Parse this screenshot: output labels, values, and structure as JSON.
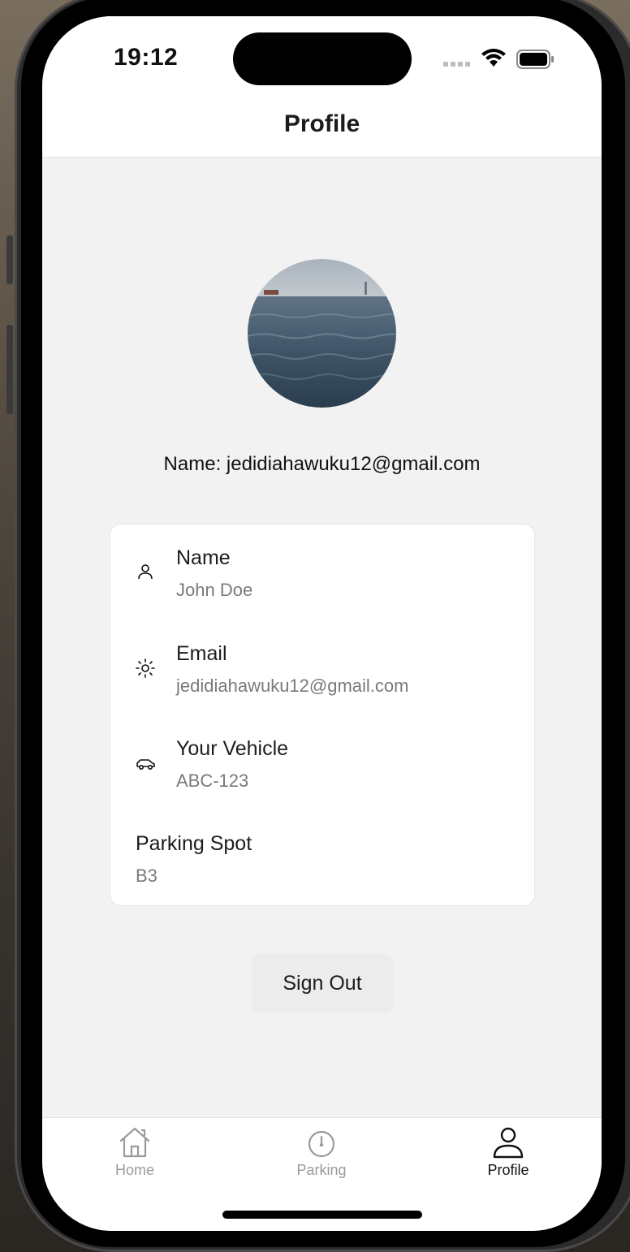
{
  "status_bar": {
    "time": "19:12"
  },
  "header": {
    "title": "Profile"
  },
  "profile": {
    "name_line": "Name: jedidiahawuku12@gmail.com"
  },
  "details": {
    "name_label": "Name",
    "name_value": "John Doe",
    "email_label": "Email",
    "email_value": "jedidiahawuku12@gmail.com",
    "vehicle_label": "Your Vehicle",
    "vehicle_value": "ABC-123",
    "parking_label": "Parking Spot",
    "parking_value": "B3"
  },
  "actions": {
    "sign_out": "Sign Out"
  },
  "tabbar": {
    "tabs": [
      {
        "label": "Home",
        "icon": "home-icon",
        "active": false
      },
      {
        "label": "Parking",
        "icon": "parking-gauge-icon",
        "active": false
      },
      {
        "label": "Profile",
        "icon": "person-icon",
        "active": true
      }
    ]
  },
  "colors": {
    "screen_bg": "#f2f2f2",
    "card_bg": "#ffffff",
    "muted_text": "#7a7a7a",
    "inactive_tab": "#9a9a9a"
  }
}
